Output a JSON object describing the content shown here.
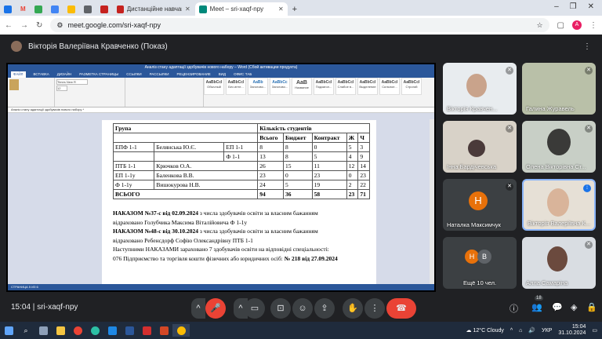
{
  "browser": {
    "tabs": [
      {
        "label": "",
        "color": "#1a73e8"
      },
      {
        "label": "M",
        "color": "#ea4335"
      },
      {
        "label": "",
        "color": "#34a853"
      },
      {
        "label": "",
        "color": "#4285f4"
      },
      {
        "label": "",
        "color": "#fbbc05"
      },
      {
        "label": "",
        "color": "#5f6368"
      },
      {
        "label": "",
        "color": "#c5221f"
      },
      {
        "label": "Дистанційне навчання в ВСП",
        "color": "#c5221f"
      },
      {
        "label": "Meet – sri-xaqf-npy",
        "color": "#00897b"
      }
    ],
    "new_tab": "+",
    "url": "meet.google.com/sri-xaqf-npy",
    "profile_initial": "А"
  },
  "meet": {
    "presenter": "Вікторія Валеріївна Кравченко (Показ)",
    "time": "15:04",
    "meeting_code": "sri-xaqf-npy",
    "participant_count": "18",
    "participants": [
      {
        "name": "Вікторія Кравчен..."
      },
      {
        "name": "Галина Журавель"
      },
      {
        "name": "Інна Бардічевська"
      },
      {
        "name": "Олена Вікторівна Ст..."
      },
      {
        "name": "Наталка Максимчук",
        "initial": "Н"
      },
      {
        "name": "Вікторія Валеріївна К..."
      },
      {
        "name": "Ещё 10 чел.",
        "initials": [
          "Н",
          "В"
        ]
      },
      {
        "name": "Алла Самаріна"
      }
    ]
  },
  "word": {
    "title": "Аналіз стану адаптації здобувачів нового набору – Word (Сбой активации продукта)",
    "ribbon_tabs": [
      "ФАЙЛ",
      "ВСТАВКА",
      "ДИЗАЙН",
      "РАЗМЕТКА СТРАНИЦЫ",
      "ССЫЛКИ",
      "РАССЫЛКИ",
      "РЕЦЕНЗИРОВАНИЕ",
      "ВИД",
      "ОФИС ТАБ"
    ],
    "font": "Times New R",
    "font_size": "12",
    "styles": [
      "Обычный",
      "Без инте...",
      "Заголово...",
      "Заголово...",
      "Название",
      "Подзагол...",
      "Слабое в...",
      "Выделение",
      "Сильное...",
      "Строгий"
    ],
    "doc_tab": "Аналіз стану адаптації здобувачів нового набору *",
    "status": "СТРАНИЦА 5 ИЗ 6"
  },
  "document": {
    "table": {
      "header": [
        "Група",
        "Кількість студентів"
      ],
      "subheader": [
        "Всього",
        "Бюджет",
        "Контракт",
        "Ж",
        "Ч"
      ],
      "rows": [
        {
          "group": "ЕПФ 1-1",
          "teacher": "Белянська Ю.Є.",
          "sub": "ЕП 1-1",
          "values": [
            "8",
            "8",
            "0",
            "5",
            "3"
          ]
        },
        {
          "group": "",
          "teacher": "",
          "sub": "Ф 1-1",
          "values": [
            "13",
            "8",
            "5",
            "4",
            "9"
          ]
        },
        {
          "group": "ПТБ 1-1",
          "teacher": "Крючков О.А.",
          "sub": "",
          "values": [
            "26",
            "15",
            "11",
            "12",
            "14"
          ]
        },
        {
          "group": "ЕП 1-1у",
          "teacher": "Баленкова В.В.",
          "sub": "",
          "values": [
            "23",
            "0",
            "23",
            "0",
            "23"
          ]
        },
        {
          "group": "Ф 1-1у",
          "teacher": "Вишокурова Н.В.",
          "sub": "",
          "values": [
            "24",
            "5",
            "19",
            "2",
            "22"
          ]
        }
      ],
      "total": {
        "label": "ВСЬОГО",
        "values": [
          "94",
          "36",
          "58",
          "23",
          "71"
        ]
      }
    },
    "paragraphs": [
      {
        "bold": "НАКАЗОМ №37-с від 02.09.2024",
        "text": " з числа здобувачів освіти за власним бажанням"
      },
      {
        "bold": "",
        "text": "відраховано Голубчика Максима Віталійовича Ф 1-1у"
      },
      {
        "bold": "НАКАЗОМ №48-с   від 30.10.2024",
        "text": " з числа здобувачів освіти за власним бажанням"
      },
      {
        "bold": "",
        "text": "відраховано Ребенсдорф Софію Олександрівну ПТБ 1-1"
      },
      {
        "bold": "",
        "text": "Наступними НАКАЗАМИ зараховано 7 здобувачів освіти на відповідні спеціальності:"
      },
      {
        "bold": "",
        "text": "076 Підприємство та торгівля кошти фізичних або юридичних осіб: ",
        "bold2": "№ 218 від 27.09.2024"
      }
    ]
  },
  "taskbar": {
    "weather": "12°C Cloudy",
    "lang": "УКР",
    "time": "15:04",
    "date": "31.10.2024"
  }
}
